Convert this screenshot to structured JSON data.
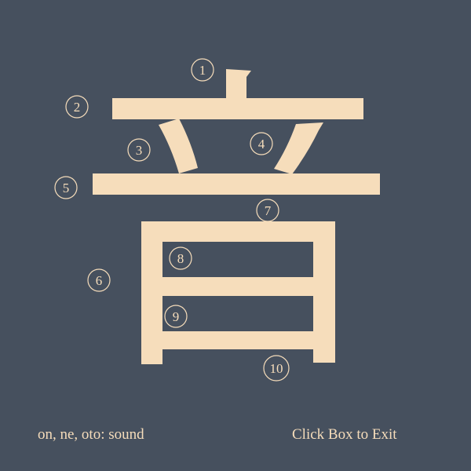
{
  "kanji": {
    "character": "音",
    "reading": "on, ne, oto: sound",
    "stroke_numbers": [
      "1",
      "2",
      "3",
      "4",
      "5",
      "6",
      "7",
      "8",
      "9",
      "10"
    ]
  },
  "exit_label": "Click Box to Exit",
  "colors": {
    "background": "#46505e",
    "stroke": "#f6ddbb"
  }
}
